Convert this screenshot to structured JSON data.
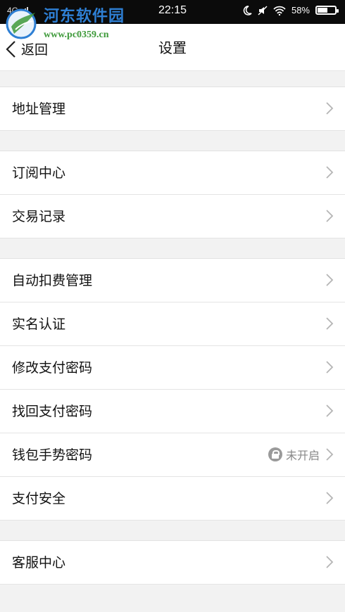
{
  "status_bar": {
    "network": "4G",
    "time": "22:15",
    "battery": "58%",
    "battery_level": 0.58,
    "icons": [
      "moon-icon",
      "mute-icon",
      "wifi-icon",
      "battery-icon"
    ]
  },
  "watermark": {
    "title": "河东软件园",
    "url": "www.pc0359.cn"
  },
  "header": {
    "back_label": "返回",
    "title": "设置"
  },
  "groups": [
    {
      "items": [
        {
          "label": "地址管理"
        }
      ]
    },
    {
      "items": [
        {
          "label": "订阅中心"
        },
        {
          "label": "交易记录"
        }
      ]
    },
    {
      "items": [
        {
          "label": "自动扣费管理"
        },
        {
          "label": "实名认证"
        },
        {
          "label": "修改支付密码"
        },
        {
          "label": "找回支付密码"
        },
        {
          "label": "钱包手势密码",
          "status": "未开启"
        },
        {
          "label": "支付安全"
        }
      ]
    },
    {
      "items": [
        {
          "label": "客服中心"
        }
      ]
    }
  ]
}
